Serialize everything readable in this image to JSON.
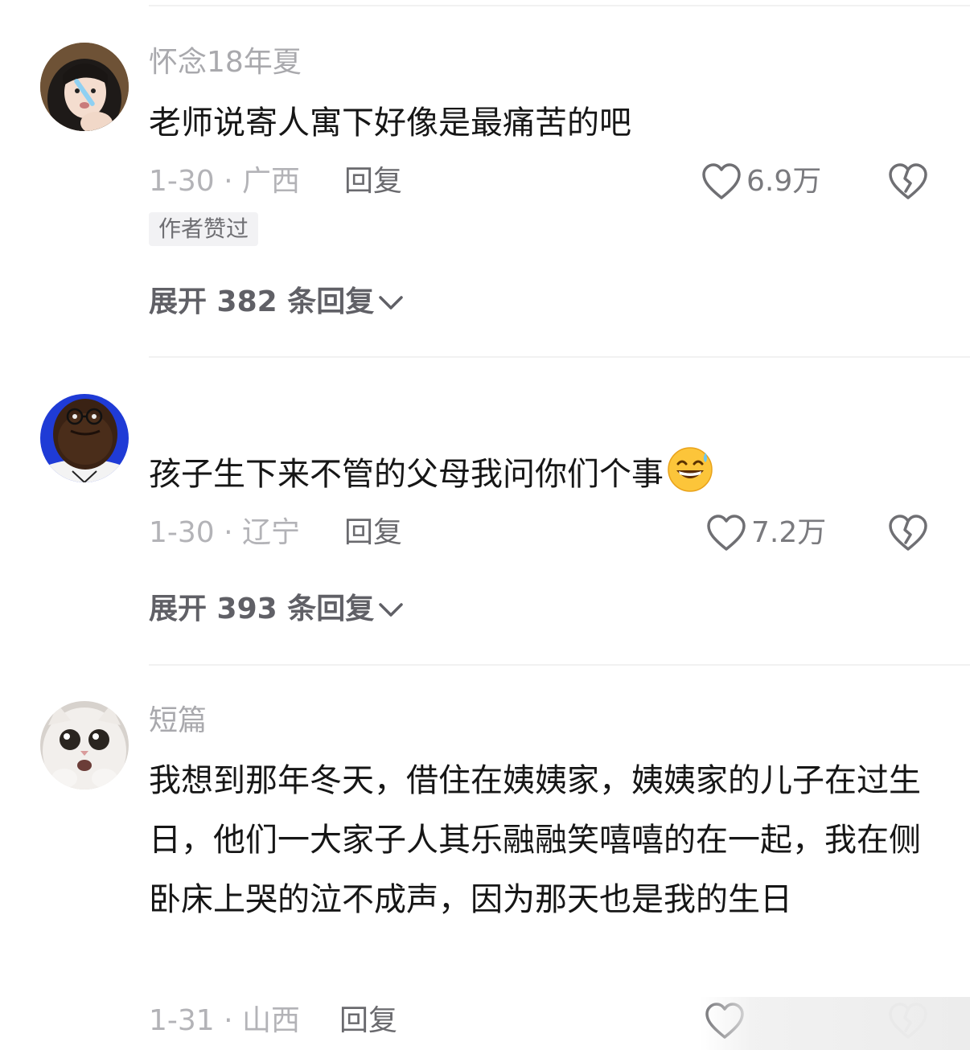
{
  "comments": [
    {
      "username": "怀念18年夏",
      "text": "老师说寄人寓下好像是最痛苦的吧",
      "date_location": "1-30 · 广西",
      "reply_label": "回复",
      "likes": "6.9万",
      "author_badge": "作者赞过",
      "expand_label": "展开 382 条回复"
    },
    {
      "username": "",
      "text": "孩子生下来不管的父母我问你们个事",
      "emoji": "grinning-sweat-emoji",
      "date_location": "1-30 · 辽宁",
      "reply_label": "回复",
      "likes": "7.2万",
      "expand_label": "展开 393 条回复"
    },
    {
      "username": "短篇",
      "text": "我想到那年冬天，借住在姨姨家，姨姨家的儿子在过生日，他们一大家子人其乐融融笑嘻嘻的在一起，我在侧卧床上哭的泣不成声，因为那天也是我的生日",
      "date_location": "1-31 · 山西",
      "reply_label": "回复"
    }
  ],
  "icons": {
    "like": "heart-outline-icon",
    "dislike": "broken-heart-icon",
    "expand": "chevron-down-icon"
  },
  "colors": {
    "text_primary": "#161616",
    "text_secondary": "#a9a9ad",
    "divider": "#f1f1f1",
    "badge_bg": "#f2f2f4"
  }
}
